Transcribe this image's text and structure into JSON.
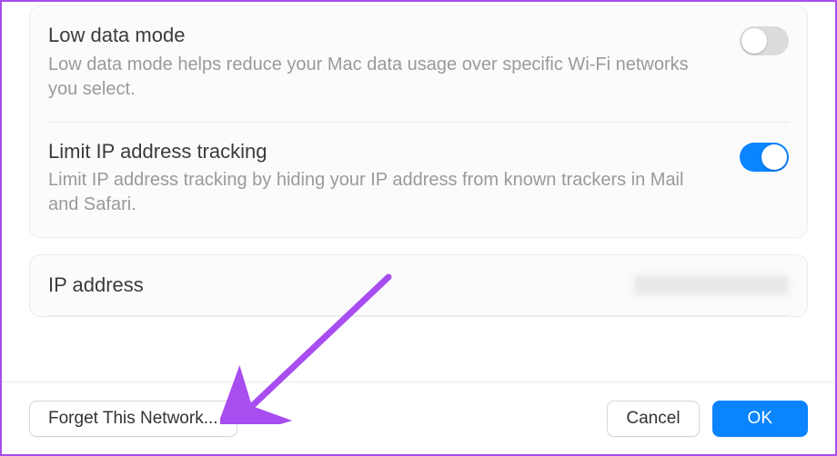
{
  "settings": [
    {
      "title": "Low data mode",
      "desc": "Low data mode helps reduce your Mac data usage over specific Wi-Fi networks you select.",
      "on": false
    },
    {
      "title": "Limit IP address tracking",
      "desc": "Limit IP address tracking by hiding your IP address from known trackers in Mail and Safari.",
      "on": true
    }
  ],
  "ip_section": {
    "label": "IP address"
  },
  "footer": {
    "forget": "Forget This Network...",
    "cancel": "Cancel",
    "ok": "OK"
  }
}
